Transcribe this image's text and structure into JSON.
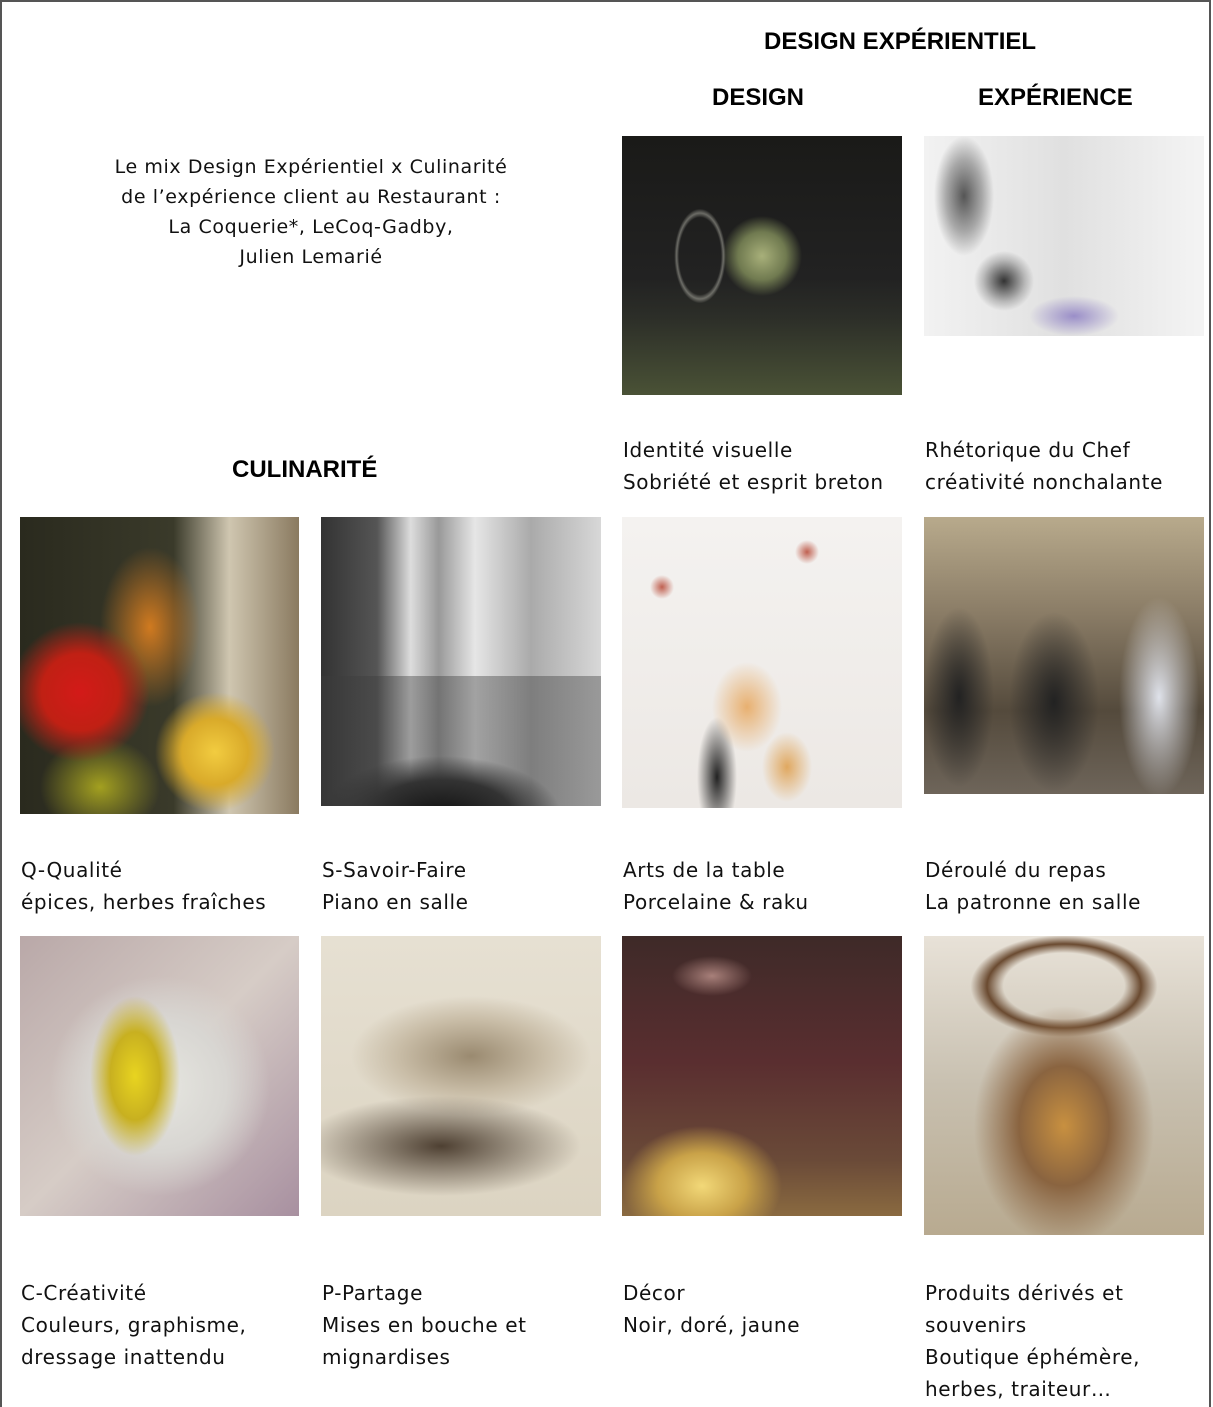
{
  "headings": {
    "design_experientiel": "DESIGN EXPÉRIENTIEL",
    "design": "DESIGN",
    "experience": "EXPÉRIENCE",
    "culinarite": "CULINARITÉ"
  },
  "intro": [
    "Le mix Design Expérientiel x Culinarité",
    "de l’expérience client au Restaurant :",
    "La Coquerie*, LeCoq-Gadby,",
    "Julien Lemarié"
  ],
  "captions": {
    "identite": [
      "Identité visuelle",
      "Sobriété et esprit breton"
    ],
    "rhetorique": [
      "Rhétorique du Chef",
      "créativité nonchalante"
    ],
    "qualite": [
      "Q-Qualité",
      "épices, herbes fraîches"
    ],
    "savoir_faire": [
      "S-Savoir-Faire",
      "Piano en salle"
    ],
    "arts_table": [
      "Arts de la table",
      "Porcelaine & raku"
    ],
    "deroule": [
      "Déroulé du repas",
      "La patronne en salle"
    ],
    "creativite": [
      "C-Créativité",
      "Couleurs, graphisme,",
      "dressage inattendu"
    ],
    "partage": [
      "P-Partage",
      "Mises en bouche et",
      "mignardises"
    ],
    "decor": [
      "Décor",
      "Noir, doré, jaune"
    ],
    "produits": [
      "Produits dérivés et",
      "souvenirs",
      "Boutique éphémère,",
      "herbes, traiteur…"
    ]
  }
}
